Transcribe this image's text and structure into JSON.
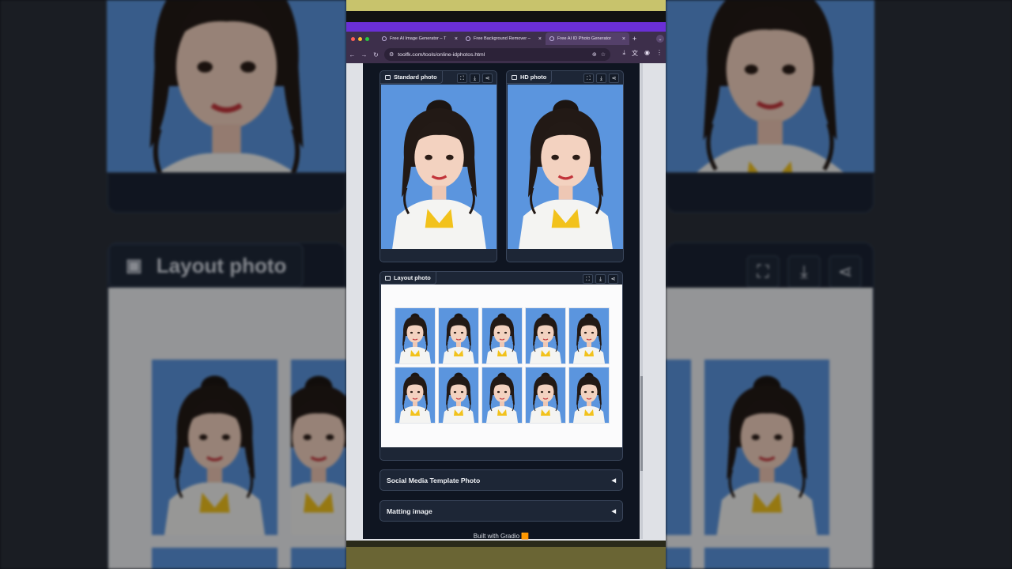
{
  "browser": {
    "tabs": [
      {
        "title": "Free AI Image Generator – T",
        "active": false
      },
      {
        "title": "Free Background Remover –",
        "active": false
      },
      {
        "title": "Free AI ID Photo Generator",
        "active": true
      }
    ],
    "new_tab": "+",
    "close_glyph": "×",
    "url": "toolfk.com/tools/online-idphotos.html"
  },
  "cards": {
    "standard": {
      "label": "Standard photo"
    },
    "hd": {
      "label": "HD photo"
    },
    "layout": {
      "label": "Layout photo"
    }
  },
  "accordions": [
    {
      "label": "Social Media Template Photo",
      "caret": "◀"
    },
    {
      "label": "Matting image",
      "caret": "◀"
    }
  ],
  "footer": "Built with Gradio 🟧",
  "background": {
    "layout_label": "Layout photo"
  },
  "colors": {
    "photo_bg": "#5b95de",
    "app_bg": "#0f1521",
    "card_bg": "#1d2636",
    "browser_frame": "#3d2f4b",
    "accent_purple": "#6a2fd6"
  },
  "icons": {
    "fullscreen": "fullscreen-icon",
    "download": "download-icon",
    "share": "share-icon",
    "image": "image-icon"
  }
}
